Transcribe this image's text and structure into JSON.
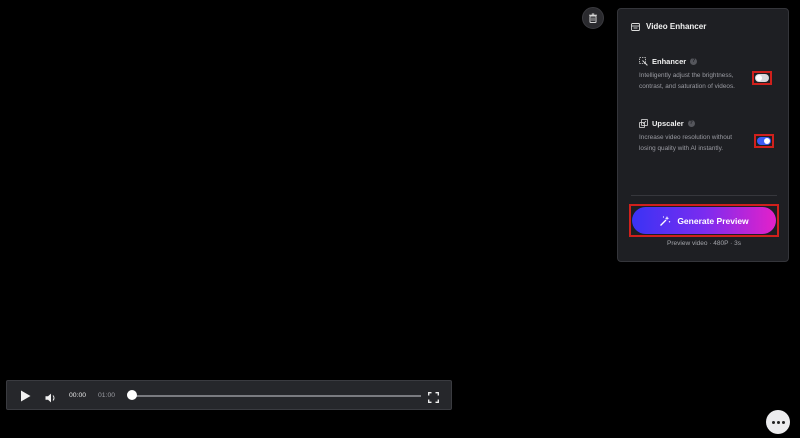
{
  "panel": {
    "title": "Video Enhancer",
    "enhancer": {
      "name": "Enhancer",
      "help": "?",
      "description": "Intelligently adjust the brightness, contrast, and saturation of videos.",
      "enabled": false
    },
    "upscaler": {
      "name": "Upscaler",
      "help": "?",
      "description": "Increase video resolution without losing quality with AI instantly.",
      "enabled": true
    },
    "generate_label": "Generate Preview",
    "preview_note": "Preview video · 480P · 3s"
  },
  "player": {
    "current_time": "00:00",
    "duration": "01:00",
    "progress": 0
  },
  "colors": {
    "accent_blue": "#3b5cf6",
    "gradient_start": "#3a33f4",
    "gradient_end": "#e421c9",
    "highlight_red": "#d0201c"
  },
  "icons": [
    "trash-icon",
    "enhancer-panel-icon",
    "magic-wand-icon",
    "upscale-icon",
    "help-icon",
    "sparkle-wand-icon",
    "play-icon",
    "volume-icon",
    "fullscreen-icon",
    "more-icon"
  ]
}
